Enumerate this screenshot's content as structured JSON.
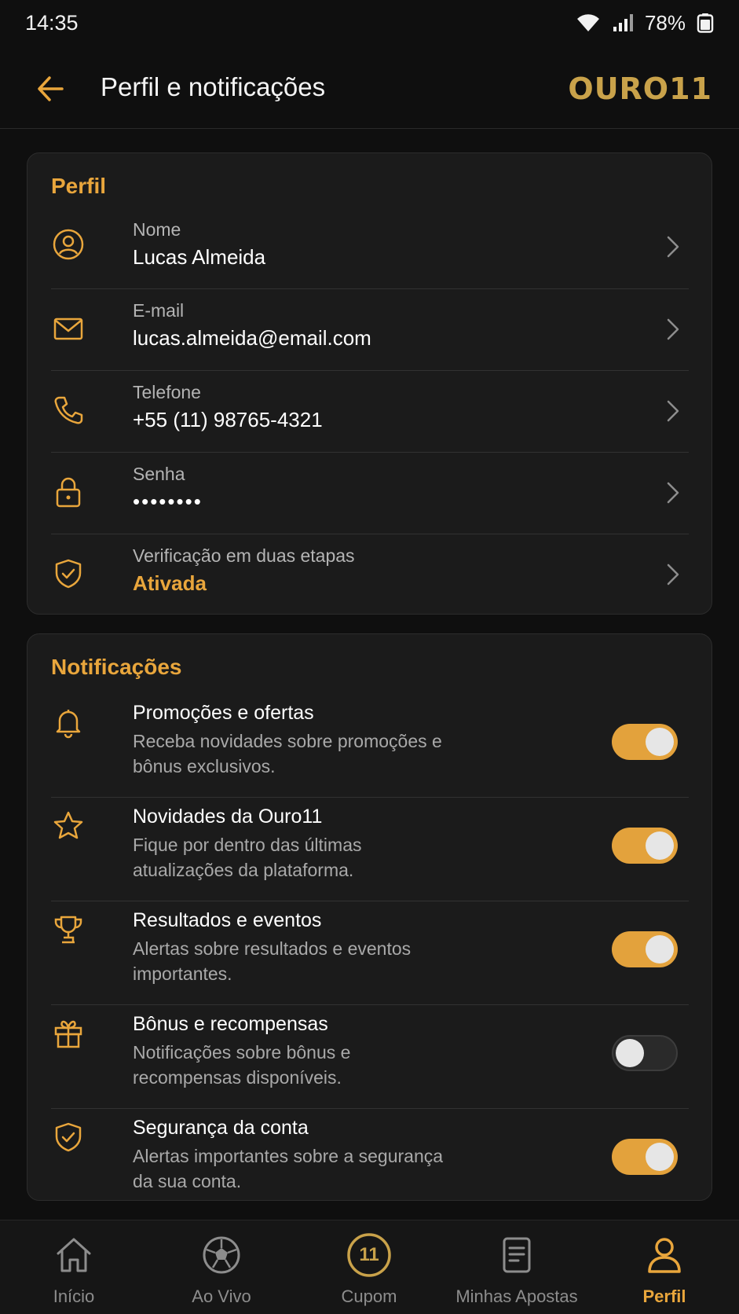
{
  "status_bar": {
    "time": "14:35",
    "battery": "78%"
  },
  "header": {
    "title": "Perfil e notificações",
    "brand": "OURO11"
  },
  "profile": {
    "section_title": "Perfil",
    "rows": [
      {
        "label": "Nome",
        "value": "Lucas Almeida",
        "icon": "user-icon"
      },
      {
        "label": "E-mail",
        "value": "lucas.almeida@email.com",
        "icon": "mail-icon"
      },
      {
        "label": "Telefone",
        "value": "+55 (11) 98765-4321",
        "icon": "phone-icon"
      },
      {
        "label": "Senha",
        "value": "••••••••",
        "icon": "lock-icon"
      },
      {
        "label": "Verificação em duas etapas",
        "value": "Ativada",
        "icon": "shield-check-icon"
      }
    ]
  },
  "notifications": {
    "section_title": "Notificações",
    "items": [
      {
        "title": "Promoções e ofertas",
        "description": "Receba novidades sobre promoções e bônus exclusivos.",
        "enabled": true,
        "icon": "bell-icon"
      },
      {
        "title": "Novidades da Ouro11",
        "description": "Fique por dentro das últimas atualizações da plataforma.",
        "enabled": true,
        "icon": "star-icon"
      },
      {
        "title": "Resultados e eventos",
        "description": "Alertas sobre resultados e eventos importantes.",
        "enabled": true,
        "icon": "trophy-icon"
      },
      {
        "title": "Bônus e recompensas",
        "description": "Notificações sobre bônus e recompensas disponíveis.",
        "enabled": false,
        "icon": "gift-icon"
      },
      {
        "title": "Segurança da conta",
        "description": "Alertas importantes sobre a segurança da sua conta.",
        "enabled": true,
        "icon": "shield-check-icon"
      }
    ]
  },
  "bottom_nav": {
    "items": [
      {
        "label": "Início",
        "icon": "home-icon",
        "active": false
      },
      {
        "label": "Ao Vivo",
        "icon": "soccer-ball-icon",
        "active": false
      },
      {
        "label": "Cupom",
        "icon": "cupom-11-icon",
        "badge": "11",
        "active": false
      },
      {
        "label": "Minhas Apostas",
        "icon": "bet-slip-icon",
        "active": false
      },
      {
        "label": "Perfil",
        "icon": "user-icon",
        "active": true
      }
    ]
  },
  "colors": {
    "accent": "#e9a63c",
    "background": "#0f0f0f",
    "card": "#1b1b1b",
    "brand_gold": "#c9a24a"
  }
}
